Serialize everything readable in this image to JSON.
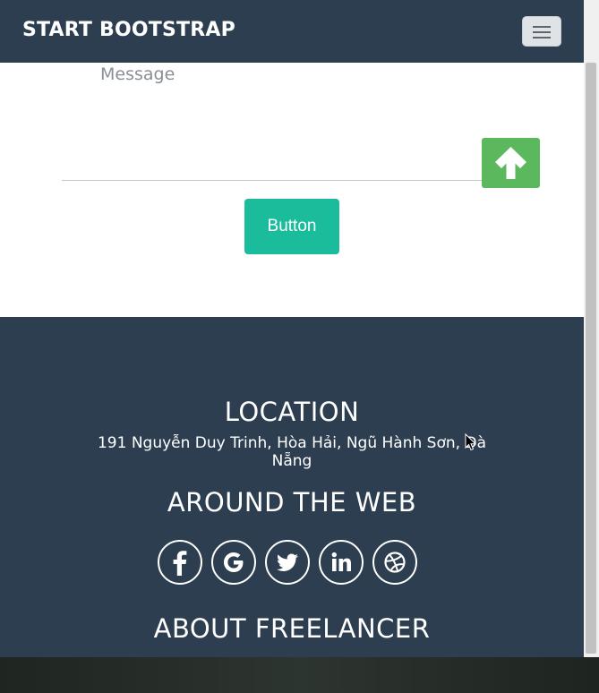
{
  "navbar": {
    "brand": "START BOOTSTRAP"
  },
  "form": {
    "message_placeholder": "Message",
    "submit_label": "Button"
  },
  "footer": {
    "location_title": "LOCATION",
    "address": "191 Nguyễn Duy Trinh, Hòa Hải, Ngũ Hành Sơn, Đà Nẵng",
    "around_title": "AROUND THE WEB",
    "about_title": "ABOUT FREELANCER"
  },
  "social_icons": [
    "facebook-icon",
    "google-icon",
    "twitter-icon",
    "linkedin-icon",
    "dribbble-icon"
  ],
  "colors": {
    "navbar": "#2c3e50",
    "footer": "#2c3e50",
    "accent_button": "#1abc9c",
    "scroll_top_button": "#5cb85c"
  }
}
